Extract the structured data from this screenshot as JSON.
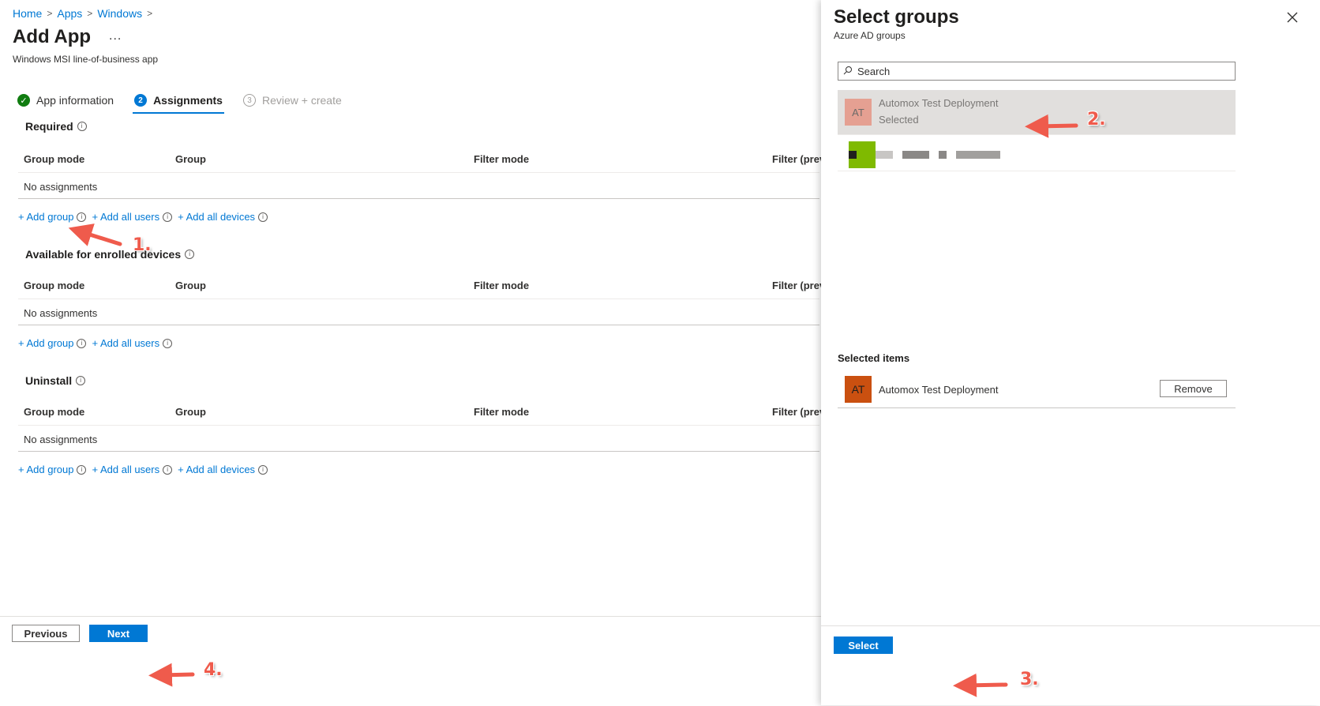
{
  "breadcrumb": [
    "Home",
    "Apps",
    "Windows"
  ],
  "page": {
    "title": "Add App",
    "more": "...",
    "subtitle": "Windows MSI line-of-business app"
  },
  "steps": [
    {
      "marker": "✓",
      "label": "App information",
      "state": "done"
    },
    {
      "marker": "2",
      "label": "Assignments",
      "state": "active"
    },
    {
      "marker": "3",
      "label": "Review + create",
      "state": "pending"
    }
  ],
  "columns": [
    "Group mode",
    "Group",
    "Filter mode",
    "Filter (prev"
  ],
  "sections": [
    {
      "title": "Required",
      "empty_text": "No assignments",
      "actions": [
        "+ Add group",
        "+ Add all users",
        "+ Add all devices"
      ]
    },
    {
      "title": "Available for enrolled devices",
      "empty_text": "No assignments",
      "actions": [
        "+ Add group",
        "+ Add all users"
      ]
    },
    {
      "title": "Uninstall",
      "empty_text": "No assignments",
      "actions": [
        "+ Add group",
        "+ Add all users",
        "+ Add all devices"
      ]
    }
  ],
  "footer": {
    "previous": "Previous",
    "next": "Next"
  },
  "panel": {
    "title": "Select groups",
    "subtitle": "Azure AD groups",
    "close_icon": "close-icon",
    "search_placeholder": "Search",
    "results": [
      {
        "initials": "AT",
        "name": "Automox Test Deployment",
        "status": "Selected"
      }
    ],
    "selected_heading": "Selected items",
    "selected_items": [
      {
        "initials": "AT",
        "name": "Automox Test Deployment",
        "remove_label": "Remove"
      }
    ],
    "select_button": "Select"
  },
  "annotations": [
    "1.",
    "2.",
    "3.",
    "4."
  ],
  "colors": {
    "accent": "#0078d4",
    "annotation": "#ef5b4c",
    "avatar": "#ca5010",
    "success": "#107c10"
  }
}
